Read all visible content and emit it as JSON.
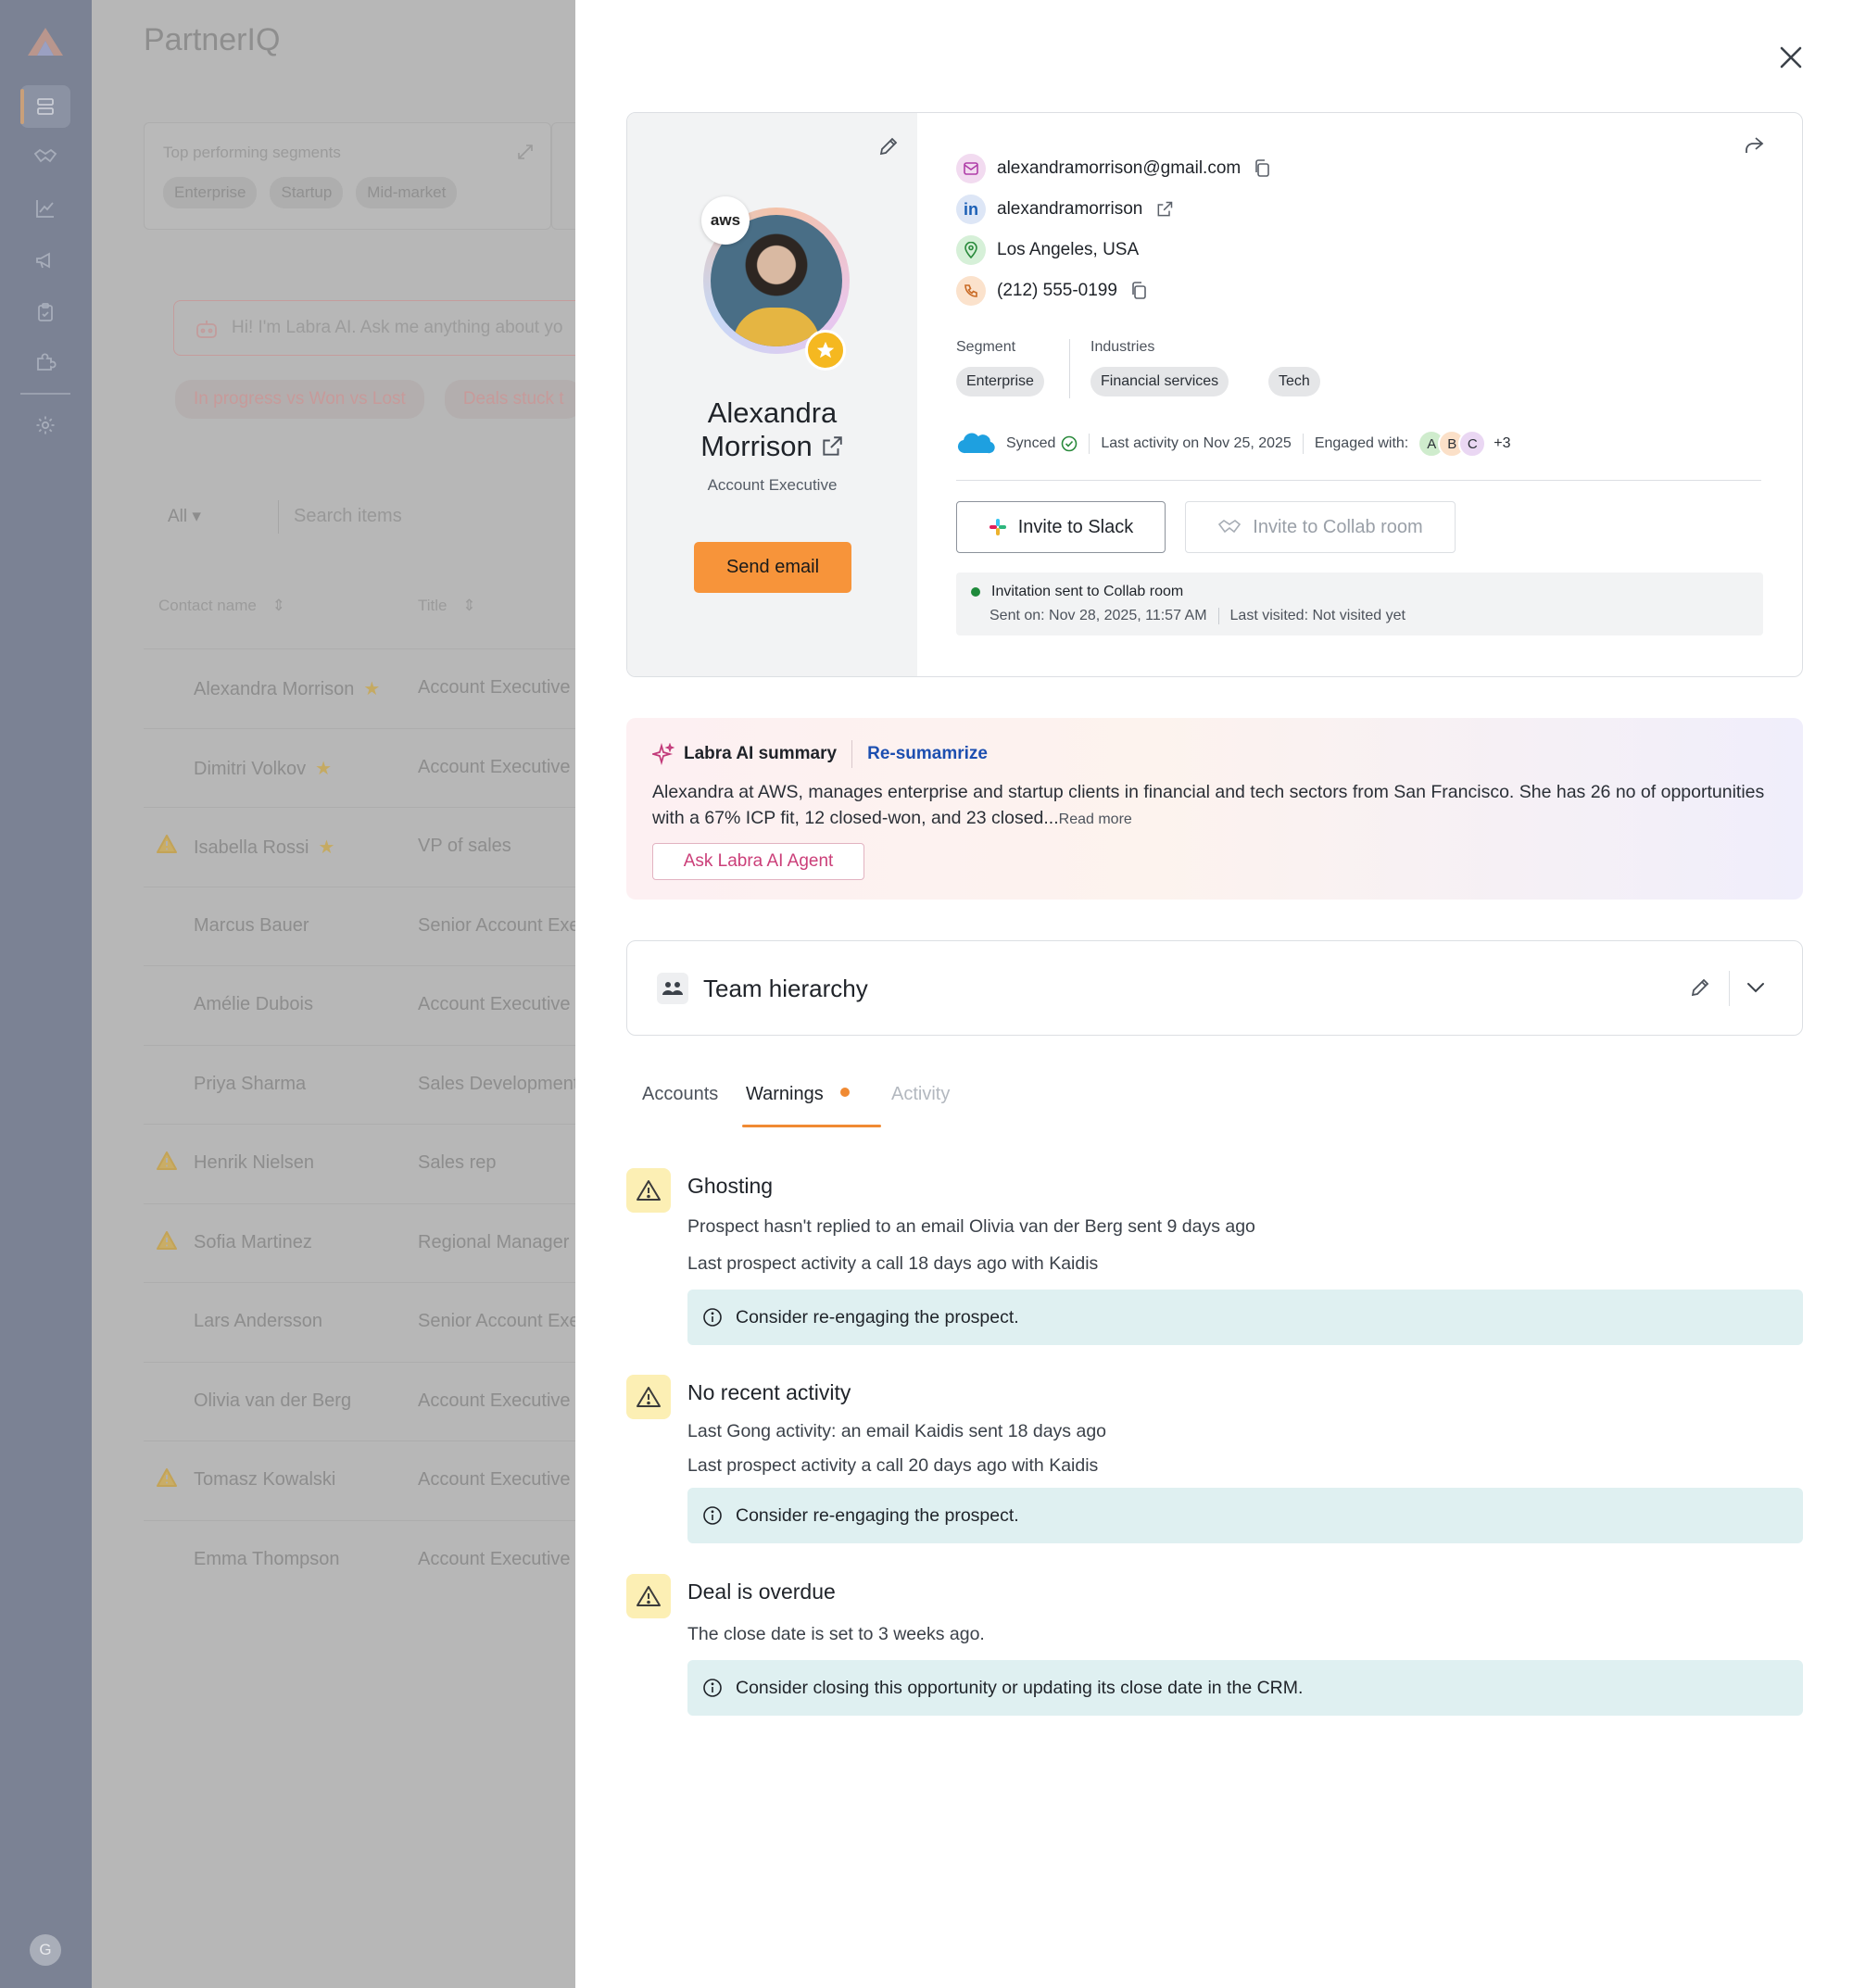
{
  "rail": {
    "nav_icons": [
      "layers-icon",
      "handshake-icon",
      "chart-line-icon",
      "megaphone-icon",
      "clipboard-icon",
      "puzzle-icon",
      "gear-icon"
    ],
    "user_initial": "G"
  },
  "background": {
    "app_title": "PartnerIQ",
    "segments_label": "Top performing segments",
    "segment_chips": [
      "Enterprise",
      "Startup",
      "Mid-market"
    ],
    "ai_placeholder": "Hi! I'm Labra AI. Ask me anything about yo",
    "suggestions": [
      "In progress vs Won vs Lost",
      "Deals stuck t"
    ],
    "filter_all": "All",
    "search_placeholder": "Search items",
    "col_contact": "Contact name",
    "col_title": "Title",
    "rows": [
      {
        "name": "Alexandra Morrison",
        "title": "Account Executive",
        "star": true,
        "warn": false
      },
      {
        "name": "Dimitri Volkov",
        "title": "Account Executive",
        "star": true,
        "warn": false
      },
      {
        "name": "Isabella Rossi",
        "title": "VP of sales",
        "star": true,
        "warn": true
      },
      {
        "name": "Marcus Bauer",
        "title": "Senior Account Exe",
        "star": false,
        "warn": false
      },
      {
        "name": "Amélie Dubois",
        "title": "Account Executive",
        "star": false,
        "warn": false
      },
      {
        "name": "Priya Sharma",
        "title": "Sales Development",
        "star": false,
        "warn": false
      },
      {
        "name": "Henrik Nielsen",
        "title": "Sales rep",
        "star": false,
        "warn": true
      },
      {
        "name": "Sofia Martinez",
        "title": "Regional Manager",
        "star": false,
        "warn": true
      },
      {
        "name": "Lars Andersson",
        "title": "Senior Account Exe",
        "star": false,
        "warn": false
      },
      {
        "name": "Olivia van der Berg",
        "title": "Account Executive",
        "star": false,
        "warn": false
      },
      {
        "name": "Tomasz Kowalski",
        "title": "Account Executive",
        "star": false,
        "warn": true
      },
      {
        "name": "Emma Thompson",
        "title": "Account Executive",
        "star": false,
        "warn": false
      }
    ]
  },
  "profile": {
    "first_name": "Alexandra",
    "last_name": "Morrison",
    "role": "Account Executive",
    "company_badge": "aws",
    "send_email_label": "Send email",
    "email": "alexandramorrison@gmail.com",
    "linkedin": "alexandramorrison",
    "linkedin_glyph": "in",
    "location": "Los Angeles, USA",
    "phone": "(212) 555-0199",
    "segment_label": "Segment",
    "segment": "Enterprise",
    "industries_label": "Industries",
    "industries": [
      "Financial services",
      "Tech"
    ],
    "sync_status": "Synced",
    "last_activity": "Last activity on Nov 25, 2025",
    "engaged_label": "Engaged with:",
    "engaged": [
      {
        "initial": "A",
        "color": "#cfeccd"
      },
      {
        "initial": "B",
        "color": "#fbe0c8"
      },
      {
        "initial": "C",
        "color": "#ead7f3"
      }
    ],
    "engaged_more": "+3",
    "slack_label": "Invite to Slack",
    "collab_label": "Invite to Collab room",
    "invite_status": "Invitation sent to Collab room",
    "invite_sent": "Sent on: Nov 28, 2025, 11:57 AM",
    "invite_visited": "Last visited: Not visited yet"
  },
  "ai_summary": {
    "title": "Labra AI summary",
    "resummarize": "Re-sumamrize",
    "body": "Alexandra at AWS, manages enterprise and startup clients in financial and tech sectors from San Francisco. She has 26 no of opportunities with a 67% ICP fit, 12 closed-won, and 23 closed...",
    "read_more": "Read more",
    "ask_label": "Ask Labra AI Agent"
  },
  "team": {
    "title": "Team hierarchy"
  },
  "tabs": [
    {
      "label": "Accounts"
    },
    {
      "label": "Warnings",
      "active": true
    },
    {
      "label": "Activity",
      "disabled": true
    }
  ],
  "warnings": [
    {
      "title": "Ghosting",
      "lines": [
        "Prospect hasn't replied to an email Olivia van der Berg sent 9 days ago",
        "Last prospect activity a call 18 days ago with Kaidis"
      ],
      "tip": "Consider re-engaging the prospect."
    },
    {
      "title": "No recent activity",
      "lines": [
        "Last Gong activity: an email Kaidis sent 18 days ago",
        "Last prospect activity a call 20 days ago with Kaidis"
      ],
      "tip": "Consider re-engaging the prospect."
    },
    {
      "title": "Deal is overdue",
      "lines": [
        "The close date is set to 3 weeks ago."
      ],
      "tip": "Consider closing this opportunity or updating its close date in the CRM."
    }
  ],
  "colors": {
    "accent_orange": "#f7943a",
    "tab_underline": "#f08a33",
    "link_blue": "#1c4fb0",
    "ai_pink": "#cb3f79",
    "warning_bg": "#fcefb4",
    "tip_bg": "#dff0f1"
  }
}
